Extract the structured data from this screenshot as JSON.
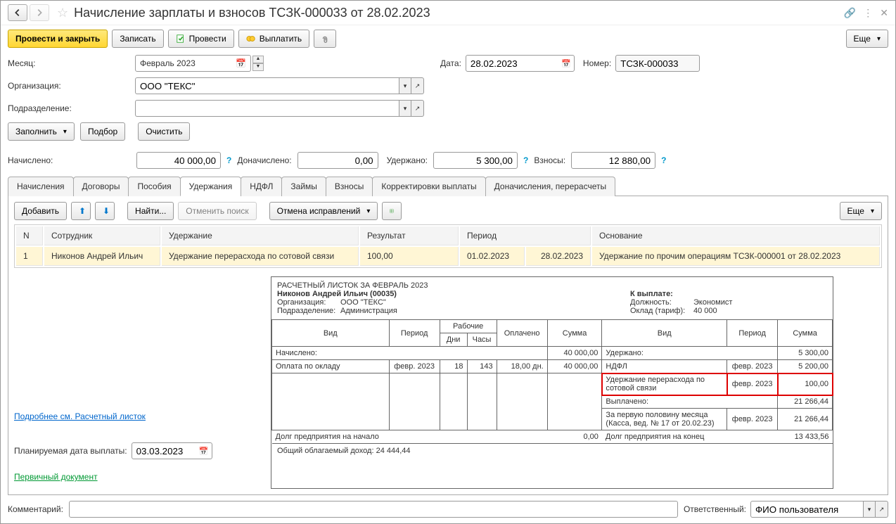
{
  "header": {
    "title": "Начисление зарплаты и взносов ТСЗК-000033 от 28.02.2023"
  },
  "toolbar": {
    "post_close": "Провести и закрыть",
    "save": "Записать",
    "post": "Провести",
    "pay": "Выплатить",
    "more": "Еще"
  },
  "form": {
    "month_label": "Месяц:",
    "month_value": "Февраль 2023",
    "date_label": "Дата:",
    "date_value": "28.02.2023",
    "number_label": "Номер:",
    "number_value": "ТСЗК-000033",
    "org_label": "Организация:",
    "org_value": "ООО \"ТЕКС\"",
    "dept_label": "Подразделение:",
    "dept_value": "",
    "fill_btn": "Заполнить",
    "select_btn": "Подбор",
    "clear_btn": "Очистить"
  },
  "totals": {
    "accrued_label": "Начислено:",
    "accrued_value": "40 000,00",
    "addl_label": "Доначислено:",
    "addl_value": "0,00",
    "withheld_label": "Удержано:",
    "withheld_value": "5 300,00",
    "contrib_label": "Взносы:",
    "contrib_value": "12 880,00"
  },
  "tabs": {
    "accruals": "Начисления",
    "contracts": "Договоры",
    "benefits": "Пособия",
    "deductions": "Удержания",
    "ndfl": "НДФЛ",
    "loans": "Займы",
    "contributions": "Взносы",
    "corrections": "Корректировки выплаты",
    "recalc": "Доначисления, перерасчеты"
  },
  "tab_toolbar": {
    "add": "Добавить",
    "find": "Найти...",
    "cancel_search": "Отменить поиск",
    "cancel_fixes": "Отмена исправлений",
    "more": "Еще"
  },
  "grid": {
    "col_n": "N",
    "col_employee": "Сотрудник",
    "col_deduction": "Удержание",
    "col_result": "Результат",
    "col_period": "Период",
    "col_basis": "Основание",
    "rows": [
      {
        "n": "1",
        "employee": "Никонов Андрей Ильич",
        "deduction": "Удержание перерасхода по сотовой связи",
        "result": "100,00",
        "period_from": "01.02.2023",
        "period_to": "28.02.2023",
        "basis": "Удержание по прочим операциям ТСЗК-000001 от 28.02.2023"
      }
    ]
  },
  "payslip": {
    "title": "РАСЧЕТНЫЙ ЛИСТОК ЗА ФЕВРАЛЬ 2023",
    "employee": "Никонов Андрей Ильич (00035)",
    "pay_label": "К выплате:",
    "org_label": "Организация:",
    "org_value": "ООО \"ТЕКС\"",
    "position_label": "Должность:",
    "position_value": "Экономист",
    "dept_label": "Подразделение:",
    "dept_value": "Администрация",
    "rate_label": "Оклад (тариф):",
    "rate_value": "40 000",
    "h_type": "Вид",
    "h_period": "Период",
    "h_working": "Рабочие",
    "h_days": "Дни",
    "h_hours": "Часы",
    "h_paid": "Оплачено",
    "h_sum": "Сумма",
    "left": {
      "accrued_label": "Начислено:",
      "accrued_sum": "40 000,00",
      "rows": [
        {
          "type": "Оплата по окладу",
          "period": "февр. 2023",
          "days": "18",
          "hours": "143",
          "paid": "18,00 дн.",
          "sum": "40 000,00"
        }
      ]
    },
    "right": {
      "withheld_label": "Удержано:",
      "withheld_sum": "5 300,00",
      "rows_w": [
        {
          "type": "НДФЛ",
          "period": "февр. 2023",
          "sum": "5 200,00"
        },
        {
          "type": "Удержание перерасхода по сотовой связи",
          "period": "февр. 2023",
          "sum": "100,00",
          "highlight": true
        }
      ],
      "paid_label": "Выплачено:",
      "paid_sum": "21 266,44",
      "rows_p": [
        {
          "type": "За первую половину месяца (Касса, вед. № 17 от 20.02.23)",
          "period": "февр. 2023",
          "sum": "21 266,44"
        }
      ]
    },
    "debt_start_label": "Долг предприятия на начало",
    "debt_start_value": "0,00",
    "debt_end_label": "Долг предприятия на конец",
    "debt_end_value": "13 433,56",
    "taxable_label": "Общий облагаемый доход:",
    "taxable_value": "24 444,44"
  },
  "links": {
    "details": "Подробнее см. Расчетный листок",
    "primary_doc": "Первичный документ"
  },
  "bottom": {
    "planned_date_label": "Планируемая дата выплаты:",
    "planned_date_value": "03.03.2023",
    "comment_label": "Комментарий:",
    "responsible_label": "Ответственный:",
    "responsible_value": "ФИО пользователя"
  }
}
